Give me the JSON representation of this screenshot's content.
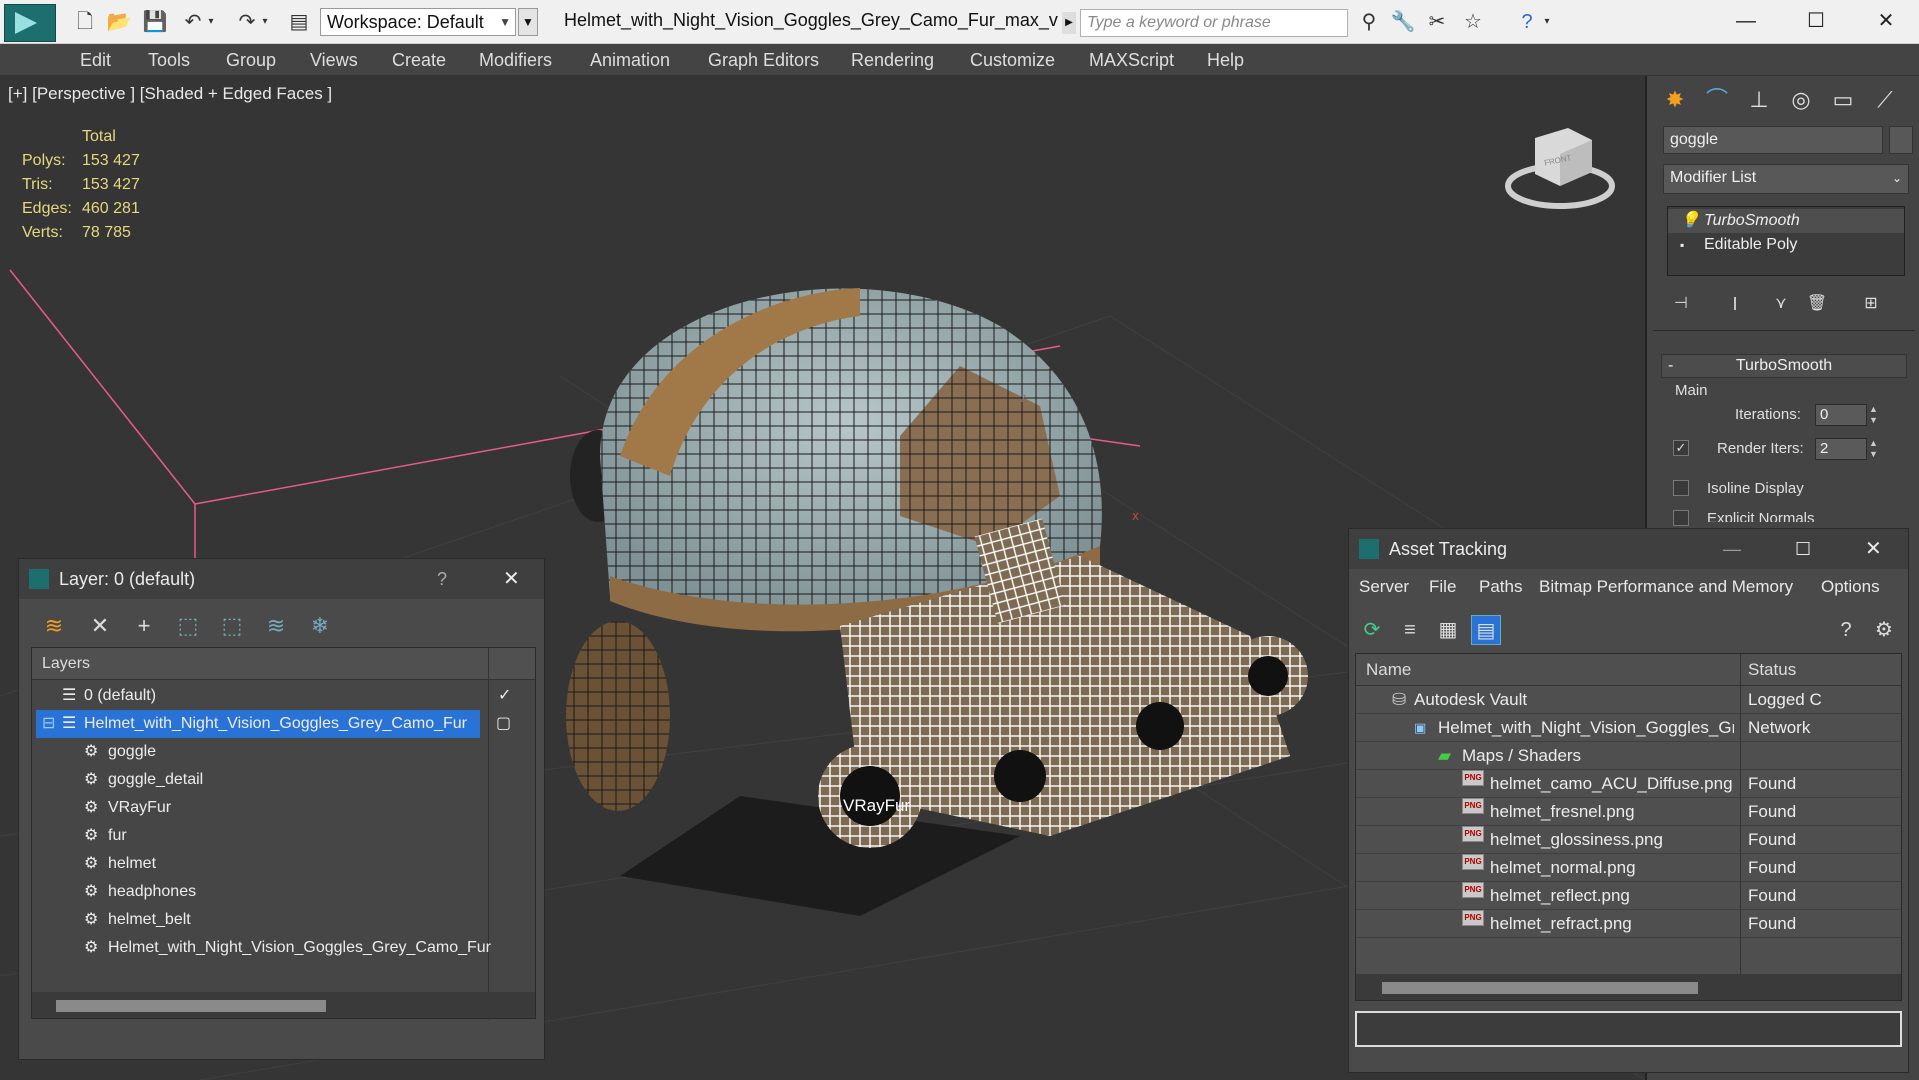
{
  "titlebar": {
    "workspace": "Workspace: Default",
    "file_title": "Helmet_with_Night_Vision_Goggles_Grey_Camo_Fur_max_vr...",
    "search_placeholder": "Type a keyword or phrase"
  },
  "menu": [
    "Edit",
    "Tools",
    "Group",
    "Views",
    "Create",
    "Modifiers",
    "Animation",
    "Graph Editors",
    "Rendering",
    "Customize",
    "MAXScript",
    "Help"
  ],
  "viewport": {
    "label": "[+] [Perspective ] [Shaded + Edged Faces ]",
    "stats_header": "Total",
    "stats": [
      {
        "label": "Polys:",
        "value": "153 427"
      },
      {
        "label": "Tris:",
        "value": "153 427"
      },
      {
        "label": "Edges:",
        "value": "460 281"
      },
      {
        "label": "Verts:",
        "value": "78 785"
      }
    ],
    "overlay_text": "VRayFur",
    "viewcube_label": "FRONT"
  },
  "command_panel": {
    "object_name": "goggle",
    "modifier_list": "Modifier List",
    "stack": [
      "TurboSmooth",
      "Editable Poly"
    ],
    "rollout_title": "TurboSmooth",
    "group_main": "Main",
    "iterations_label": "Iterations:",
    "iterations_value": "0",
    "render_iters_label": "Render Iters:",
    "render_iters_value": "2",
    "isoline_label": "Isoline Display",
    "explicit_label": "Explicit Normals"
  },
  "layer_window": {
    "title": "Layer: 0 (default)",
    "help": "?",
    "column_header": "Layers",
    "rows": [
      {
        "name": "0 (default)",
        "indent": 1,
        "type": "layer"
      },
      {
        "name": "Helmet_with_Night_Vision_Goggles_Grey_Camo_Fur",
        "indent": 1,
        "type": "layer",
        "selected": true
      },
      {
        "name": "goggle",
        "indent": 2,
        "type": "object"
      },
      {
        "name": "goggle_detail",
        "indent": 2,
        "type": "object"
      },
      {
        "name": "VRayFur",
        "indent": 2,
        "type": "object"
      },
      {
        "name": "fur",
        "indent": 2,
        "type": "object"
      },
      {
        "name": "helmet",
        "indent": 2,
        "type": "object"
      },
      {
        "name": "headphones",
        "indent": 2,
        "type": "object"
      },
      {
        "name": "helmet_belt",
        "indent": 2,
        "type": "object"
      },
      {
        "name": "Helmet_with_Night_Vision_Goggles_Grey_Camo_Fur",
        "indent": 2,
        "type": "object"
      }
    ]
  },
  "asset_window": {
    "title": "Asset Tracking",
    "menu": [
      "Server",
      "File",
      "Paths",
      "Bitmap Performance and Memory",
      "Options"
    ],
    "col_name": "Name",
    "col_status": "Status",
    "rows": [
      {
        "name": "Autodesk Vault",
        "status": "Logged C",
        "indent": 1,
        "icon": "vault"
      },
      {
        "name": "Helmet_with_Night_Vision_Goggles_Grey_Cam...",
        "status": "Network",
        "indent": 2,
        "icon": "max"
      },
      {
        "name": "Maps / Shaders",
        "status": "",
        "indent": 3,
        "icon": "folder"
      },
      {
        "name": "helmet_camo_ACU_Diffuse.png",
        "status": "Found",
        "indent": 4,
        "icon": "png"
      },
      {
        "name": "helmet_fresnel.png",
        "status": "Found",
        "indent": 4,
        "icon": "png"
      },
      {
        "name": "helmet_glossiness.png",
        "status": "Found",
        "indent": 4,
        "icon": "png"
      },
      {
        "name": "helmet_normal.png",
        "status": "Found",
        "indent": 4,
        "icon": "png"
      },
      {
        "name": "helmet_reflect.png",
        "status": "Found",
        "indent": 4,
        "icon": "png"
      },
      {
        "name": "helmet_refract.png",
        "status": "Found",
        "indent": 4,
        "icon": "png"
      }
    ]
  },
  "colors": {
    "accent": "#1d6e6e",
    "selection": "#2a73d6",
    "stats": "#e6d87e"
  }
}
